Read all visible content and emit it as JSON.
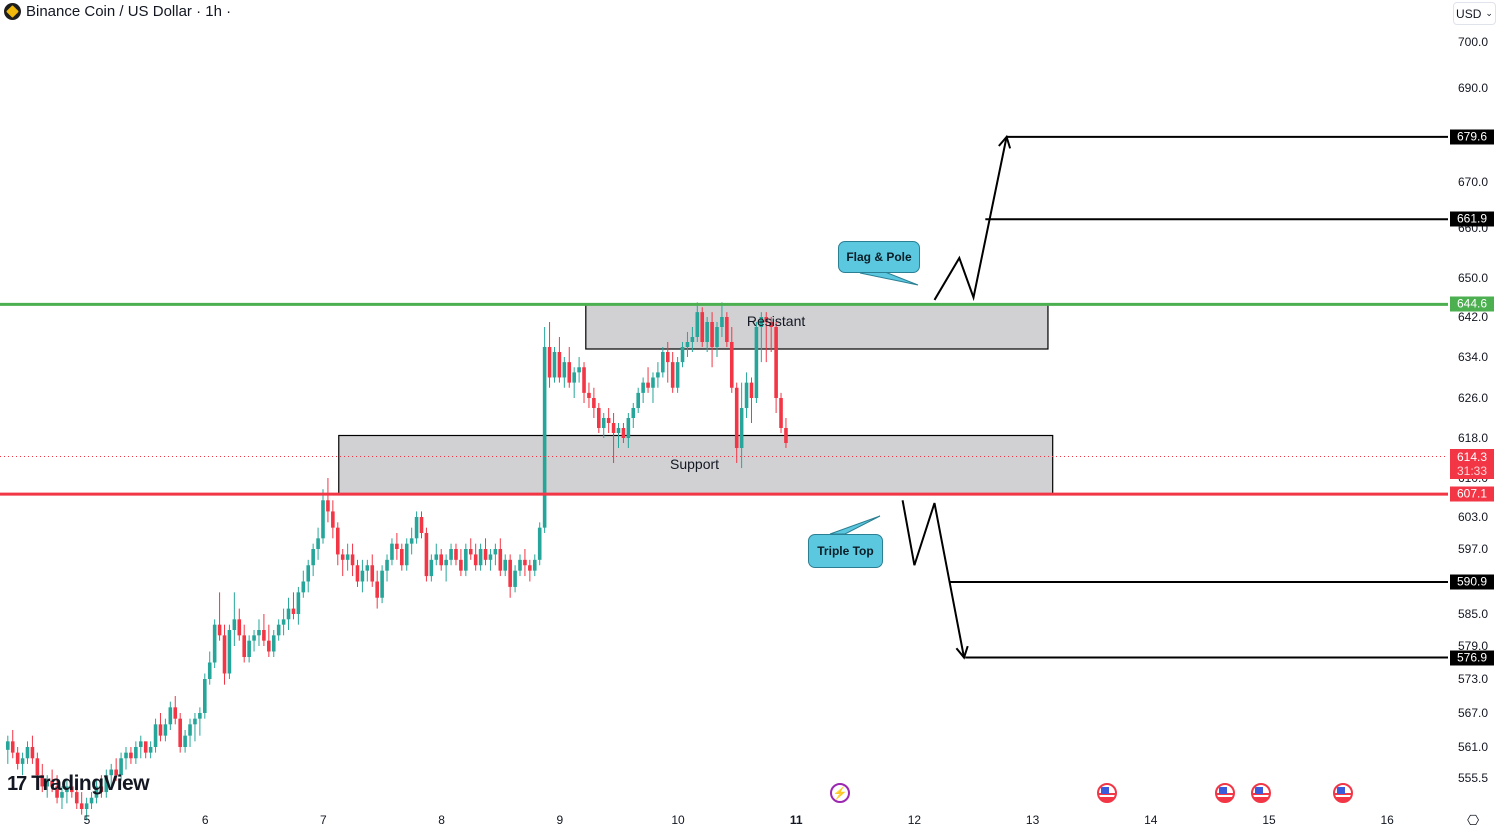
{
  "header": {
    "title": "Binance Coin / US Dollar · 1h ·",
    "symbol_icon": "binance-coin-icon"
  },
  "currency_selector": {
    "label": "USD",
    "icon": "chevron-down-icon"
  },
  "branding": {
    "logo_mark": "17",
    "logo_text": "TradingView"
  },
  "colors": {
    "up": "#26a69a",
    "down": "#f23645",
    "resistance_line": "#4caf50",
    "support_line": "#f23645",
    "zone_fill": "#d1d1d4",
    "callout_fill": "#5bc8e0",
    "target_tag": "#000000"
  },
  "chart_data": {
    "type": "candlestick",
    "title": "Binance Coin / US Dollar · 1h",
    "xlabel": "",
    "ylabel": "",
    "y_ticks": [
      {
        "value": 700.0,
        "label": "700.0"
      },
      {
        "value": 690.0,
        "label": "690.0"
      },
      {
        "value": 670.0,
        "label": "670.0"
      },
      {
        "value": 660.0,
        "label": "660.0"
      },
      {
        "value": 650.0,
        "label": "650.0"
      },
      {
        "value": 642.0,
        "label": "642.0"
      },
      {
        "value": 634.0,
        "label": "634.0"
      },
      {
        "value": 626.0,
        "label": "626.0"
      },
      {
        "value": 618.0,
        "label": "618.0"
      },
      {
        "value": 610.0,
        "label": "610.0"
      },
      {
        "value": 603.0,
        "label": "603.0"
      },
      {
        "value": 597.0,
        "label": "597.0"
      },
      {
        "value": 585.0,
        "label": "585.0"
      },
      {
        "value": 579.0,
        "label": "579.0"
      },
      {
        "value": 573.0,
        "label": "573.0"
      },
      {
        "value": 567.0,
        "label": "567.0"
      },
      {
        "value": 561.0,
        "label": "561.0"
      },
      {
        "value": 555.5,
        "label": "555.5"
      }
    ],
    "x_ticks": [
      {
        "day": 5,
        "label": "5",
        "bold": false
      },
      {
        "day": 6,
        "label": "6",
        "bold": false
      },
      {
        "day": 7,
        "label": "7",
        "bold": false
      },
      {
        "day": 8,
        "label": "8",
        "bold": false
      },
      {
        "day": 9,
        "label": "9",
        "bold": false
      },
      {
        "day": 10,
        "label": "10",
        "bold": false
      },
      {
        "day": 11,
        "label": "11",
        "bold": true
      },
      {
        "day": 12,
        "label": "12",
        "bold": false
      },
      {
        "day": 13,
        "label": "13",
        "bold": false
      },
      {
        "day": 14,
        "label": "14",
        "bold": false
      },
      {
        "day": 15,
        "label": "15",
        "bold": false
      },
      {
        "day": 16,
        "label": "16",
        "bold": false
      }
    ],
    "x_range_days": [
      4.28,
      16.75
    ],
    "candles_start_day": 4.33,
    "candle_interval_hours": 1,
    "candles": [
      [
        560.5,
        563,
        558,
        562
      ],
      [
        562,
        564,
        559,
        560
      ],
      [
        560,
        561,
        557,
        558
      ],
      [
        558,
        560,
        556,
        559
      ],
      [
        559,
        562,
        558,
        561
      ],
      [
        561,
        563,
        558,
        559
      ],
      [
        559,
        560,
        555,
        556
      ],
      [
        556,
        558,
        553,
        554
      ],
      [
        554,
        556,
        552,
        555
      ],
      [
        555,
        557,
        553,
        554
      ],
      [
        554,
        556,
        551,
        552
      ],
      [
        552,
        554,
        550,
        553
      ],
      [
        553,
        555,
        551,
        554
      ],
      [
        554,
        556,
        552,
        553
      ],
      [
        553,
        554,
        550,
        551
      ],
      [
        551,
        553,
        549,
        550
      ],
      [
        550,
        552,
        548,
        551
      ],
      [
        551,
        553,
        550,
        552
      ],
      [
        552,
        555,
        551,
        554
      ],
      [
        554,
        556,
        552,
        553
      ],
      [
        553,
        557,
        552,
        556
      ],
      [
        556,
        558,
        554,
        557
      ],
      [
        557,
        559,
        555,
        556
      ],
      [
        556,
        560,
        555,
        559
      ],
      [
        559,
        561,
        557,
        560
      ],
      [
        560,
        561,
        558,
        559
      ],
      [
        559,
        562,
        558,
        561
      ],
      [
        561,
        563,
        559,
        562
      ],
      [
        562,
        561,
        559,
        560
      ],
      [
        560,
        562,
        559,
        561
      ],
      [
        561,
        566,
        560,
        565
      ],
      [
        565,
        567,
        562,
        563
      ],
      [
        563,
        566,
        562,
        565
      ],
      [
        565,
        569,
        564,
        568
      ],
      [
        568,
        570,
        565,
        566
      ],
      [
        566,
        567,
        560,
        561
      ],
      [
        561,
        564,
        560,
        563
      ],
      [
        563,
        566,
        561,
        565
      ],
      [
        565,
        567,
        562,
        566
      ],
      [
        566,
        568,
        563,
        567
      ],
      [
        567,
        574,
        566,
        573
      ],
      [
        573,
        578,
        572,
        576
      ],
      [
        576,
        584,
        575,
        583
      ],
      [
        583,
        589,
        580,
        581
      ],
      [
        581,
        583,
        572,
        574
      ],
      [
        574,
        583,
        573,
        582
      ],
      [
        582,
        589,
        579,
        584
      ],
      [
        584,
        586,
        580,
        581
      ],
      [
        581,
        583,
        576,
        577
      ],
      [
        577,
        581,
        576,
        580
      ],
      [
        580,
        582,
        578,
        581
      ],
      [
        581,
        584,
        579,
        582
      ],
      [
        582,
        585,
        579,
        580
      ],
      [
        580,
        583,
        577,
        578
      ],
      [
        578,
        582,
        577,
        581
      ],
      [
        581,
        584,
        580,
        583
      ],
      [
        583,
        586,
        581,
        584
      ],
      [
        584,
        588,
        582,
        586
      ],
      [
        586,
        589,
        584,
        585
      ],
      [
        585,
        590,
        583,
        589
      ],
      [
        589,
        593,
        588,
        591
      ],
      [
        591,
        595,
        589,
        594
      ],
      [
        594,
        598,
        592,
        597
      ],
      [
        597,
        601,
        595,
        599
      ],
      [
        599,
        608,
        598,
        606
      ],
      [
        606,
        610,
        602,
        604
      ],
      [
        604,
        606,
        599,
        601
      ],
      [
        601,
        602,
        594,
        596
      ],
      [
        596,
        597,
        592,
        595
      ],
      [
        595,
        598,
        593,
        596
      ],
      [
        596,
        598,
        592,
        594
      ],
      [
        594,
        595,
        590,
        591
      ],
      [
        591,
        595,
        589,
        593
      ],
      [
        593,
        595,
        591,
        594
      ],
      [
        594,
        596,
        590,
        591
      ],
      [
        591,
        593,
        586,
        588
      ],
      [
        588,
        594,
        587,
        593
      ],
      [
        593,
        596,
        591,
        595
      ],
      [
        595,
        599,
        594,
        598
      ],
      [
        598,
        600,
        595,
        597
      ],
      [
        597,
        598,
        593,
        594
      ],
      [
        594,
        599,
        593,
        598
      ],
      [
        598,
        601,
        596,
        599
      ],
      [
        599,
        604,
        598,
        603
      ],
      [
        603,
        604,
        599,
        600
      ],
      [
        600,
        601,
        591,
        592
      ],
      [
        592,
        596,
        591,
        595
      ],
      [
        595,
        598,
        594,
        596
      ],
      [
        596,
        597,
        593,
        594
      ],
      [
        594,
        596,
        591,
        595
      ],
      [
        595,
        598,
        594,
        597
      ],
      [
        597,
        598,
        594,
        595
      ],
      [
        595,
        597,
        592,
        593
      ],
      [
        593,
        598,
        592,
        597
      ],
      [
        597,
        599,
        595,
        596
      ],
      [
        596,
        598,
        593,
        594
      ],
      [
        594,
        598,
        593,
        597
      ],
      [
        597,
        599,
        594,
        595
      ],
      [
        595,
        597,
        593,
        596
      ],
      [
        596,
        598,
        594,
        597
      ],
      [
        597,
        599,
        592,
        593
      ],
      [
        593,
        596,
        592,
        595
      ],
      [
        595,
        596,
        588,
        590
      ],
      [
        590,
        594,
        589,
        593
      ],
      [
        593,
        596,
        592,
        595
      ],
      [
        595,
        597,
        592,
        594
      ],
      [
        594,
        595,
        591,
        593
      ],
      [
        593,
        596,
        592,
        595
      ],
      [
        595,
        602,
        594,
        601
      ],
      [
        601,
        640,
        600,
        636
      ],
      [
        636,
        641,
        628,
        630
      ],
      [
        630,
        636,
        629,
        635
      ],
      [
        635,
        638,
        629,
        630
      ],
      [
        630,
        634,
        628,
        633
      ],
      [
        633,
        636,
        628,
        629
      ],
      [
        629,
        632,
        626,
        631
      ],
      [
        631,
        634,
        629,
        632
      ],
      [
        632,
        633,
        625,
        627
      ],
      [
        627,
        629,
        624,
        626
      ],
      [
        626,
        628,
        622,
        624
      ],
      [
        624,
        625,
        619,
        620
      ],
      [
        620,
        623,
        618,
        622
      ],
      [
        622,
        624,
        619,
        621
      ],
      [
        621,
        623,
        613,
        619
      ],
      [
        619,
        621,
        616,
        620
      ],
      [
        620,
        621,
        617,
        618
      ],
      [
        618,
        623,
        616,
        622
      ],
      [
        622,
        625,
        620,
        624
      ],
      [
        624,
        628,
        623,
        627
      ],
      [
        627,
        630,
        625,
        629
      ],
      [
        629,
        632,
        627,
        628
      ],
      [
        628,
        631,
        625,
        630
      ],
      [
        630,
        633,
        628,
        631
      ],
      [
        631,
        636,
        630,
        635
      ],
      [
        635,
        637,
        629,
        633
      ],
      [
        633,
        635,
        627,
        628
      ],
      [
        628,
        634,
        627,
        633
      ],
      [
        633,
        637,
        632,
        636
      ],
      [
        636,
        639,
        634,
        637
      ],
      [
        637,
        640,
        635,
        638
      ],
      [
        638,
        645,
        637,
        643
      ],
      [
        643,
        644,
        636,
        637
      ],
      [
        637,
        642,
        635,
        641
      ],
      [
        641,
        643,
        632,
        636
      ],
      [
        636,
        641,
        634,
        640
      ],
      [
        640,
        645,
        638,
        642
      ],
      [
        642,
        643,
        636,
        637
      ],
      [
        637,
        640,
        627,
        628
      ],
      [
        628,
        629,
        613,
        616
      ],
      [
        616,
        629,
        612,
        624
      ],
      [
        624,
        631,
        622,
        629
      ],
      [
        629,
        630,
        621,
        626
      ],
      [
        626,
        641,
        625,
        640
      ],
      [
        640,
        643,
        633,
        642
      ],
      [
        642,
        643,
        633,
        641
      ],
      [
        641,
        642,
        635,
        640
      ],
      [
        640,
        641,
        623,
        626
      ],
      [
        626,
        627,
        619,
        620
      ],
      [
        620,
        622,
        616,
        617
      ]
    ],
    "last_price": 614.3,
    "countdown": "31:33",
    "horizontal_levels": [
      {
        "name": "resistance",
        "value": 644.6,
        "label": "644.6",
        "color": "#4caf50"
      },
      {
        "name": "support",
        "value": 607.1,
        "label": "607.1",
        "color": "#f23645"
      },
      {
        "name": "target-up-1",
        "value": 661.9,
        "label": "661.9",
        "color": "#000000"
      },
      {
        "name": "target-up-2",
        "value": 679.6,
        "label": "679.6",
        "color": "#000000"
      },
      {
        "name": "target-down-1",
        "value": 590.9,
        "label": "590.9",
        "color": "#000000"
      },
      {
        "name": "target-down-2",
        "value": 576.9,
        "label": "576.9",
        "color": "#000000"
      }
    ],
    "zones": [
      {
        "name": "resistance-zone",
        "label": "Resistant",
        "top": 644.6,
        "bottom": 635.6,
        "from_day": 9.22,
        "to_day": 13.13
      },
      {
        "name": "support-zone",
        "label": "Support",
        "top": 618.5,
        "bottom": 607.1,
        "from_day": 7.13,
        "to_day": 13.17
      }
    ],
    "annotations": [
      {
        "name": "flag-pole-callout",
        "text": "Flag & Pole"
      },
      {
        "name": "triple-top-callout",
        "text": "Triple Top"
      }
    ],
    "projections": [
      {
        "name": "bullish-projection",
        "points": [
          [
            12.17,
            645.5
          ],
          [
            12.38,
            654
          ],
          [
            12.5,
            646
          ],
          [
            12.78,
            679.6
          ]
        ],
        "arrow": true
      },
      {
        "name": "bearish-projection",
        "points": [
          [
            11.9,
            606
          ],
          [
            12.0,
            594
          ],
          [
            12.17,
            605.5
          ],
          [
            12.42,
            576.9
          ]
        ],
        "arrow": true
      }
    ],
    "events": [
      {
        "type": "lightning",
        "day": 11.37
      },
      {
        "type": "us-flag",
        "day": 13.63
      },
      {
        "type": "us-flag",
        "day": 14.63
      },
      {
        "type": "us-flag",
        "day": 14.93
      },
      {
        "type": "us-flag",
        "day": 15.63
      }
    ],
    "grid": false,
    "legend": "none"
  }
}
